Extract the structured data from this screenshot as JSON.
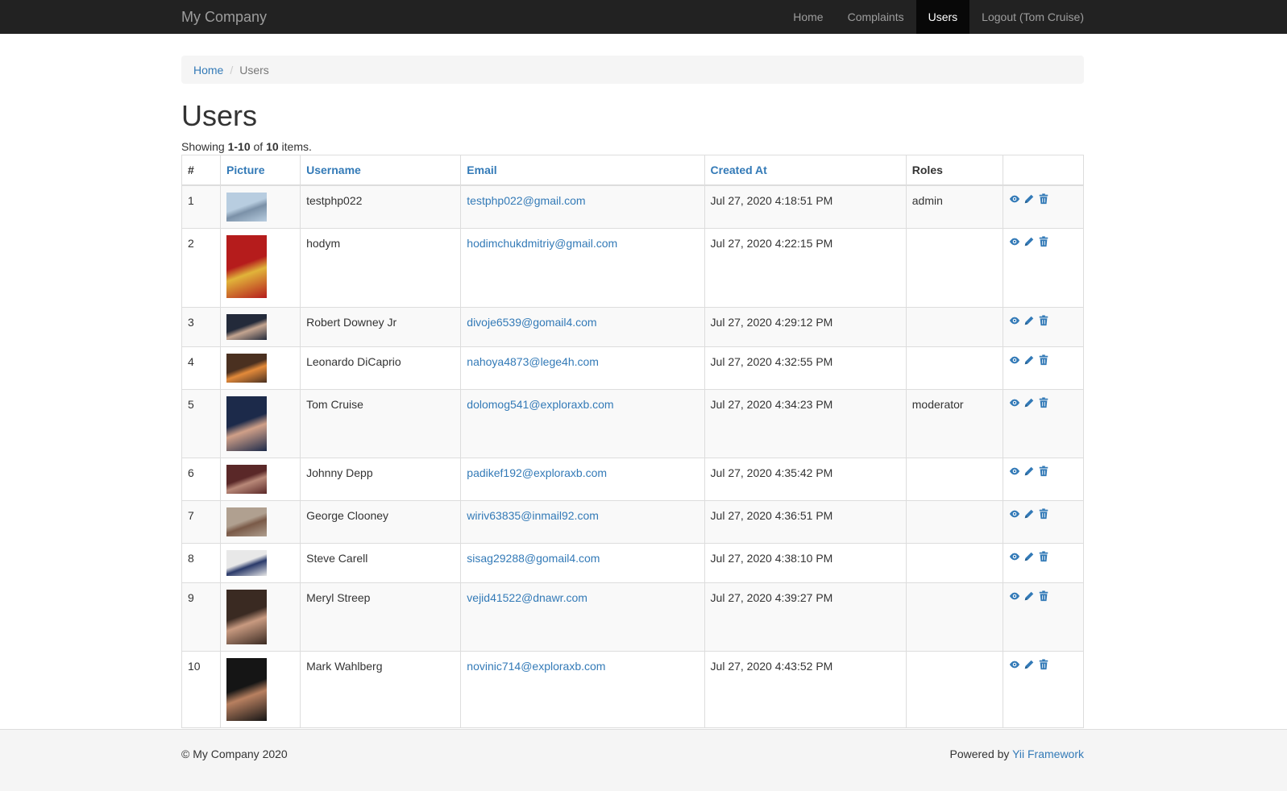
{
  "nav": {
    "brand": "My Company",
    "items": [
      {
        "label": "Home",
        "active": false
      },
      {
        "label": "Complaints",
        "active": false
      },
      {
        "label": "Users",
        "active": true
      },
      {
        "label": "Logout (Tom Cruise)",
        "active": false
      }
    ]
  },
  "breadcrumb": {
    "home": "Home",
    "separator": "/",
    "current": "Users"
  },
  "page_title": "Users",
  "summary": {
    "prefix": "Showing ",
    "range": "1-10",
    "of": " of ",
    "total": "10",
    "suffix": " items."
  },
  "table": {
    "headers": {
      "num": "#",
      "picture": "Picture",
      "username": "Username",
      "email": "Email",
      "created_at": "Created At",
      "roles": "Roles"
    },
    "rows": [
      {
        "num": "1",
        "username": "testphp022",
        "email": "testphp022@gmail.com",
        "created_at": "Jul 27, 2020 4:18:51 PM",
        "roles": "admin",
        "picture_colors": [
          "#b8cde0",
          "#7b91a8"
        ],
        "picture_aspect": "wide"
      },
      {
        "num": "2",
        "username": "hodym",
        "email": "hodimchukdmitriy@gmail.com",
        "created_at": "Jul 27, 2020 4:22:15 PM",
        "roles": "",
        "picture_colors": [
          "#b51c1c",
          "#e1b43a"
        ],
        "picture_aspect": "tall"
      },
      {
        "num": "3",
        "username": "Robert Downey Jr",
        "email": "divoje6539@gomail4.com",
        "created_at": "Jul 27, 2020 4:29:12 PM",
        "roles": "",
        "picture_colors": [
          "#232a3a",
          "#c4a590"
        ],
        "picture_aspect": "short"
      },
      {
        "num": "4",
        "username": "Leonardo DiCaprio",
        "email": "nahoya4873@lege4h.com",
        "created_at": "Jul 27, 2020 4:32:55 PM",
        "roles": "",
        "picture_colors": [
          "#4a3020",
          "#e38a3a"
        ],
        "picture_aspect": "wide"
      },
      {
        "num": "5",
        "username": "Tom Cruise",
        "email": "dolomog541@exploraxb.com",
        "created_at": "Jul 27, 2020 4:34:23 PM",
        "roles": "moderator",
        "picture_colors": [
          "#1c2a4a",
          "#d0a088"
        ],
        "picture_aspect": "portrait"
      },
      {
        "num": "6",
        "username": "Johnny Depp",
        "email": "padikef192@exploraxb.com",
        "created_at": "Jul 27, 2020 4:35:42 PM",
        "roles": "",
        "picture_colors": [
          "#5a2828",
          "#b88878"
        ],
        "picture_aspect": "wide"
      },
      {
        "num": "7",
        "username": "George Clooney",
        "email": "wiriv63835@inmail92.com",
        "created_at": "Jul 27, 2020 4:36:51 PM",
        "roles": "",
        "picture_colors": [
          "#b0a090",
          "#7a5a48"
        ],
        "picture_aspect": "square"
      },
      {
        "num": "8",
        "username": "Steve Carell",
        "email": "sisag29288@gomail4.com",
        "created_at": "Jul 27, 2020 4:38:10 PM",
        "roles": "",
        "picture_colors": [
          "#e8e8e8",
          "#2a3a6a"
        ],
        "picture_aspect": "short"
      },
      {
        "num": "9",
        "username": "Meryl Streep",
        "email": "vejid41522@dnawr.com",
        "created_at": "Jul 27, 2020 4:39:27 PM",
        "roles": "",
        "picture_colors": [
          "#3a2a22",
          "#c89a80"
        ],
        "picture_aspect": "portrait"
      },
      {
        "num": "10",
        "username": "Mark Wahlberg",
        "email": "novinic714@exploraxb.com",
        "created_at": "Jul 27, 2020 4:43:52 PM",
        "roles": "",
        "picture_colors": [
          "#151515",
          "#b88060"
        ],
        "picture_aspect": "portrait-tall"
      }
    ],
    "action_icons": [
      "eye-icon",
      "pencil-icon",
      "trash-icon"
    ]
  },
  "footer": {
    "copyright": "© My Company 2020",
    "powered_prefix": "Powered by ",
    "powered_link": "Yii Framework"
  },
  "colors": {
    "navbar": "#222222",
    "link": "#337ab7",
    "stripe": "#f9f9f9"
  }
}
